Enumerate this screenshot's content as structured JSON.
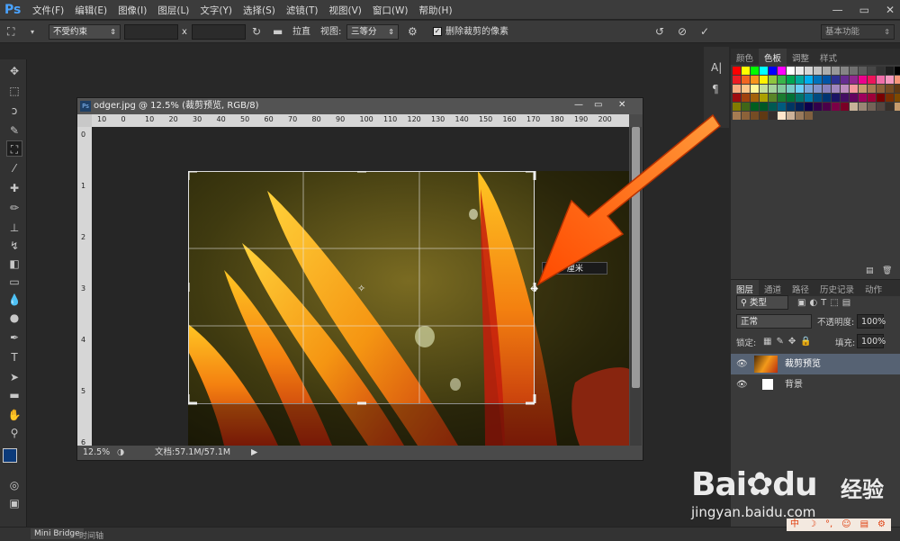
{
  "app": {
    "logo": "Ps"
  },
  "menu": [
    "文件(F)",
    "编辑(E)",
    "图像(I)",
    "图层(L)",
    "文字(Y)",
    "选择(S)",
    "滤镜(T)",
    "视图(V)",
    "窗口(W)",
    "帮助(H)"
  ],
  "window_controls": {
    "minimize": "—",
    "restore": "▭",
    "close": "✕"
  },
  "options": {
    "ratio_value": "不受约束",
    "width_value": "",
    "x_label": "x",
    "height_value": "",
    "straighten_label": "拉直",
    "view_label": "视图:",
    "view_value": "三等分",
    "delete_cropped_label": "删除裁剪的像素",
    "workspace_value": "基本功能"
  },
  "swatch_tabs": [
    "颜色",
    "色板",
    "调整",
    "样式"
  ],
  "swatch_colors": [
    "#ff0000",
    "#ffff00",
    "#00ff00",
    "#00ffff",
    "#0000ff",
    "#ff00ff",
    "#ffffff",
    "#ebebeb",
    "#d6d6d6",
    "#c2c2c2",
    "#adadad",
    "#999999",
    "#858585",
    "#707070",
    "#5c5c5c",
    "#474747",
    "#333333",
    "#1f1f1f",
    "#000000",
    "#ed1c24",
    "#f26522",
    "#f7941d",
    "#fff200",
    "#8dc63f",
    "#39b54a",
    "#00a651",
    "#00a99d",
    "#00aeef",
    "#0072bc",
    "#0054a6",
    "#2e3192",
    "#662d91",
    "#92278f",
    "#ec008c",
    "#ed145b",
    "#f06eaa",
    "#f49ac1",
    "#f7977a",
    "#f9ad81",
    "#fdc68a",
    "#fff79a",
    "#c4df9b",
    "#a3d39c",
    "#82ca9d",
    "#7accc8",
    "#6dcff6",
    "#7da7d9",
    "#8393ca",
    "#8781bd",
    "#a187be",
    "#bd8cbf",
    "#f5989d",
    "#c69c6d",
    "#a67c52",
    "#8c6239",
    "#754c24",
    "#603913",
    "#9e0b0f",
    "#a0410d",
    "#a3620a",
    "#aba000",
    "#598527",
    "#1a7b30",
    "#007236",
    "#00746b",
    "#0076a3",
    "#004b80",
    "#003471",
    "#1b1464",
    "#440e62",
    "#630460",
    "#9e005d",
    "#9e0039",
    "#790000",
    "#7b2e00",
    "#7d4900",
    "#827b00",
    "#406618",
    "#005e20",
    "#005826",
    "#005952",
    "#005b7f",
    "#003663",
    "#002157",
    "#0d004c",
    "#32004b",
    "#4b0049",
    "#7b0046",
    "#7a0026",
    "#c7b299",
    "#998675",
    "#736357",
    "#534741",
    "#37302a",
    "#c69c6d",
    "#a67c52",
    "#8c6239",
    "#754c24",
    "#603913",
    "#362f2d",
    "#ffe6cc",
    "#ccb299",
    "#997a5c",
    "#806040"
  ],
  "layers_tabs": [
    "图层",
    "通道",
    "路径",
    "历史记录",
    "动作"
  ],
  "layers": {
    "filter_label": "类型",
    "blend_mode": "正常",
    "opacity_label": "不透明度:",
    "opacity_value": "100%",
    "lock_label": "锁定:",
    "fill_label": "填充:",
    "fill_value": "100%",
    "items": [
      {
        "name": "裁剪预览",
        "selected": true
      },
      {
        "name": "背景",
        "selected": false
      }
    ]
  },
  "document": {
    "title": "odger.jpg @ 12.5% (裁剪预览, RGB/8)",
    "ruler_h": [
      "10",
      "0",
      "10",
      "20",
      "30",
      "40",
      "50",
      "60",
      "70",
      "80",
      "90",
      "100",
      "110",
      "120",
      "130",
      "140",
      "150",
      "160",
      "170",
      "180",
      "190",
      "200"
    ],
    "ruler_v": [
      "0",
      "1",
      "2",
      "3",
      "4",
      "5",
      "6"
    ],
    "zoom": "12.5%",
    "doc_size": "文档:57.1M/57.1M",
    "tooltip": "8.85 厘米"
  },
  "bottom_tabs": [
    "Mini Bridge",
    "时间轴"
  ],
  "watermark": {
    "brand": "Bai",
    "brand2": "du",
    "suffix": "经验",
    "url": "jingyan.baidu.com",
    "ime": "中"
  }
}
